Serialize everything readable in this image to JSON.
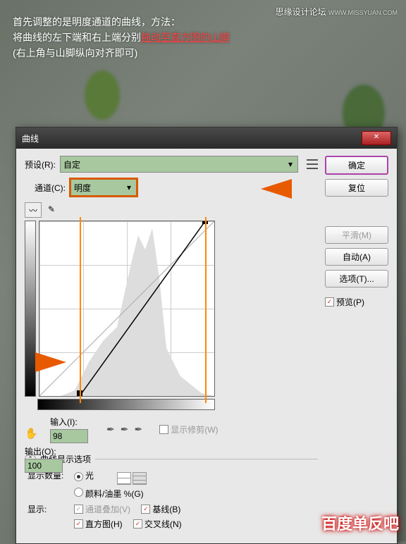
{
  "forum_text": "思缘设计论坛",
  "forum_url": "WWW.MISSYUAN.COM",
  "watermark": "百度单反吧",
  "annotation": {
    "line1": "首先调整的是明度通道的曲线，方法：",
    "line2a": "将曲线的左下端和右上端分别",
    "line2b": "拖动至直方图的山脚",
    "line3": "(右上角与山脚纵向对齐即可)"
  },
  "dialog": {
    "title": "曲线",
    "preset_label": "预设(R):",
    "preset_value": "自定",
    "channel_label": "通道(C):",
    "channel_value": "明度",
    "output_label": "输出(O):",
    "output_value": "100",
    "input_label": "输入(I):",
    "input_value": "98",
    "show_clip": "显示修剪(W)",
    "section_title": "曲线显示选项",
    "show_qty_label": "显示数量:",
    "opt_light": "光",
    "opt_ink": "颜料/油墨 %(G)",
    "show_label": "显示:",
    "chk_overlay": "通道叠加(V)",
    "chk_baseline": "基线(B)",
    "chk_histogram": "直方图(H)",
    "chk_intersect": "交叉线(N)"
  },
  "buttons": {
    "ok": "确定",
    "reset": "复位",
    "smooth": "平滑(M)",
    "auto": "自动(A)",
    "options": "选项(T)...",
    "preview": "预览(P)"
  }
}
